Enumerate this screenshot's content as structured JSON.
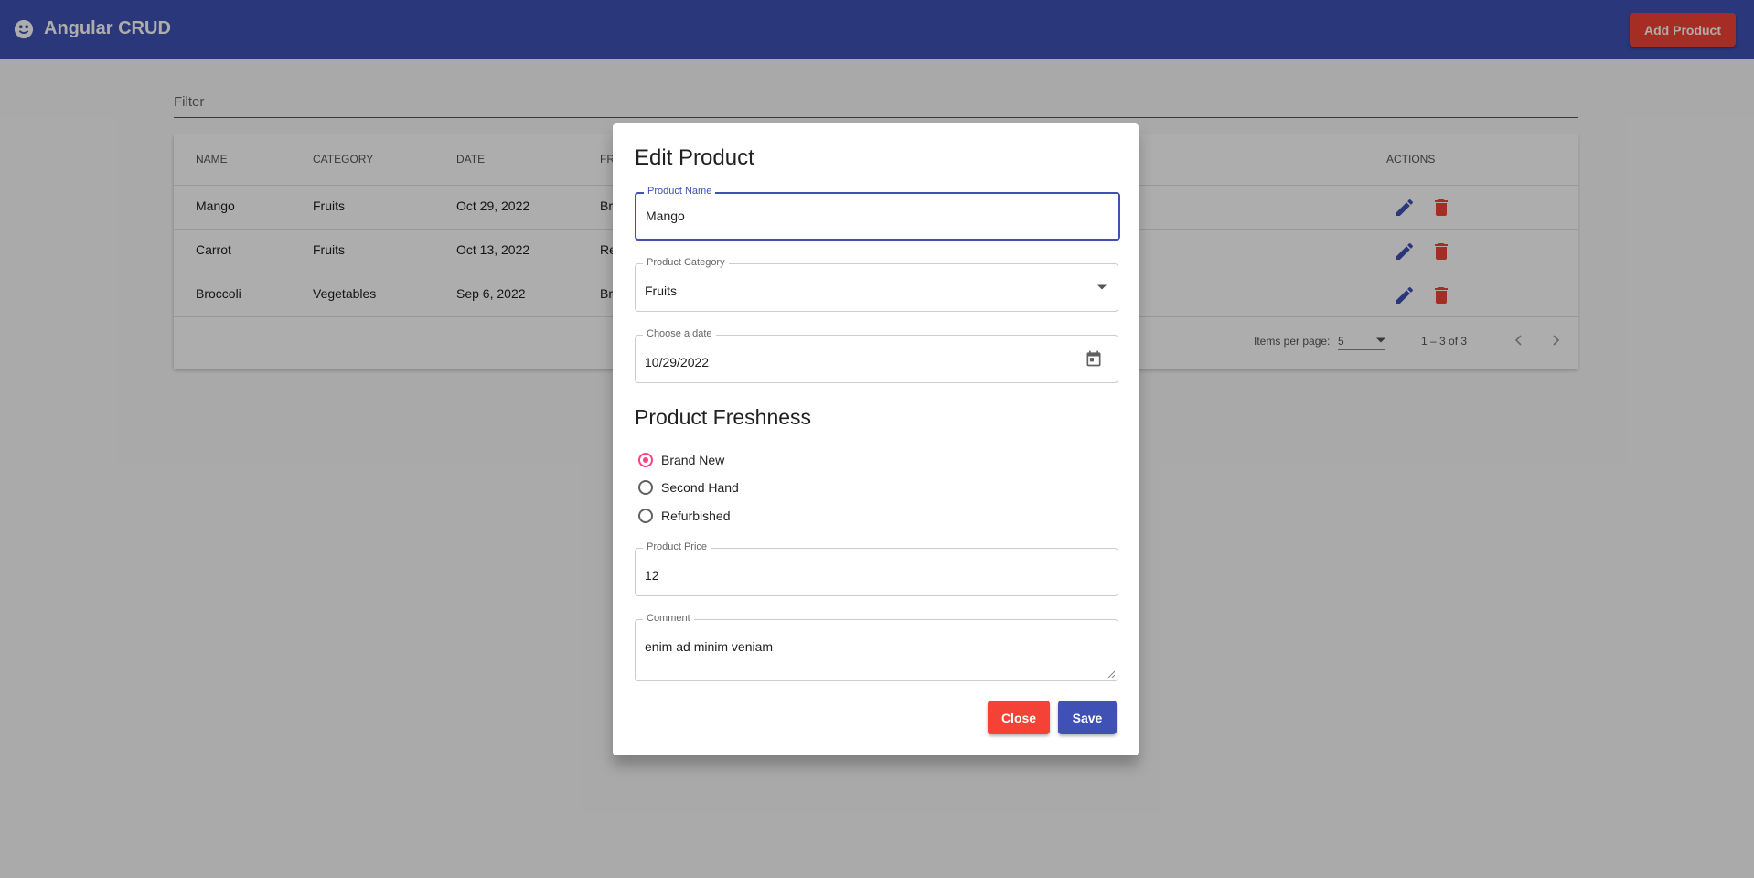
{
  "toolbar": {
    "title": "Angular CRUD",
    "add_button": "Add Product"
  },
  "filter": {
    "placeholder": "Filter"
  },
  "table": {
    "columns": [
      "NAME",
      "CATEGORY",
      "DATE",
      "FR",
      "ACTIONS"
    ],
    "rows": [
      {
        "name": "Mango",
        "category": "Fruits",
        "date": "Oct 29, 2022",
        "freshness": "Br"
      },
      {
        "name": "Carrot",
        "category": "Fruits",
        "date": "Oct 13, 2022",
        "freshness": "Re"
      },
      {
        "name": "Broccoli",
        "category": "Vegetables",
        "date": "Sep 6, 2022",
        "freshness": "Br"
      }
    ],
    "paginator": {
      "items_per_page_label": "Items per page:",
      "page_size": "5",
      "range_label": "1 – 3 of 3"
    }
  },
  "dialog": {
    "title": "Edit Product",
    "product_name": {
      "label": "Product Name",
      "value": "Mango"
    },
    "product_category": {
      "label": "Product Category",
      "value": "Fruits"
    },
    "date": {
      "label": "Choose a date",
      "value": "10/29/2022"
    },
    "freshness": {
      "title": "Product Freshness",
      "options": [
        "Brand New",
        "Second Hand",
        "Refurbished"
      ],
      "selected": "Brand New"
    },
    "price": {
      "label": "Product Price",
      "value": "12"
    },
    "comment": {
      "label": "Comment",
      "value": "enim ad minim veniam"
    },
    "close_button": "Close",
    "save_button": "Save"
  },
  "colors": {
    "primary": "#3f51b5",
    "warn": "#f44336",
    "accent": "#ff4081"
  }
}
